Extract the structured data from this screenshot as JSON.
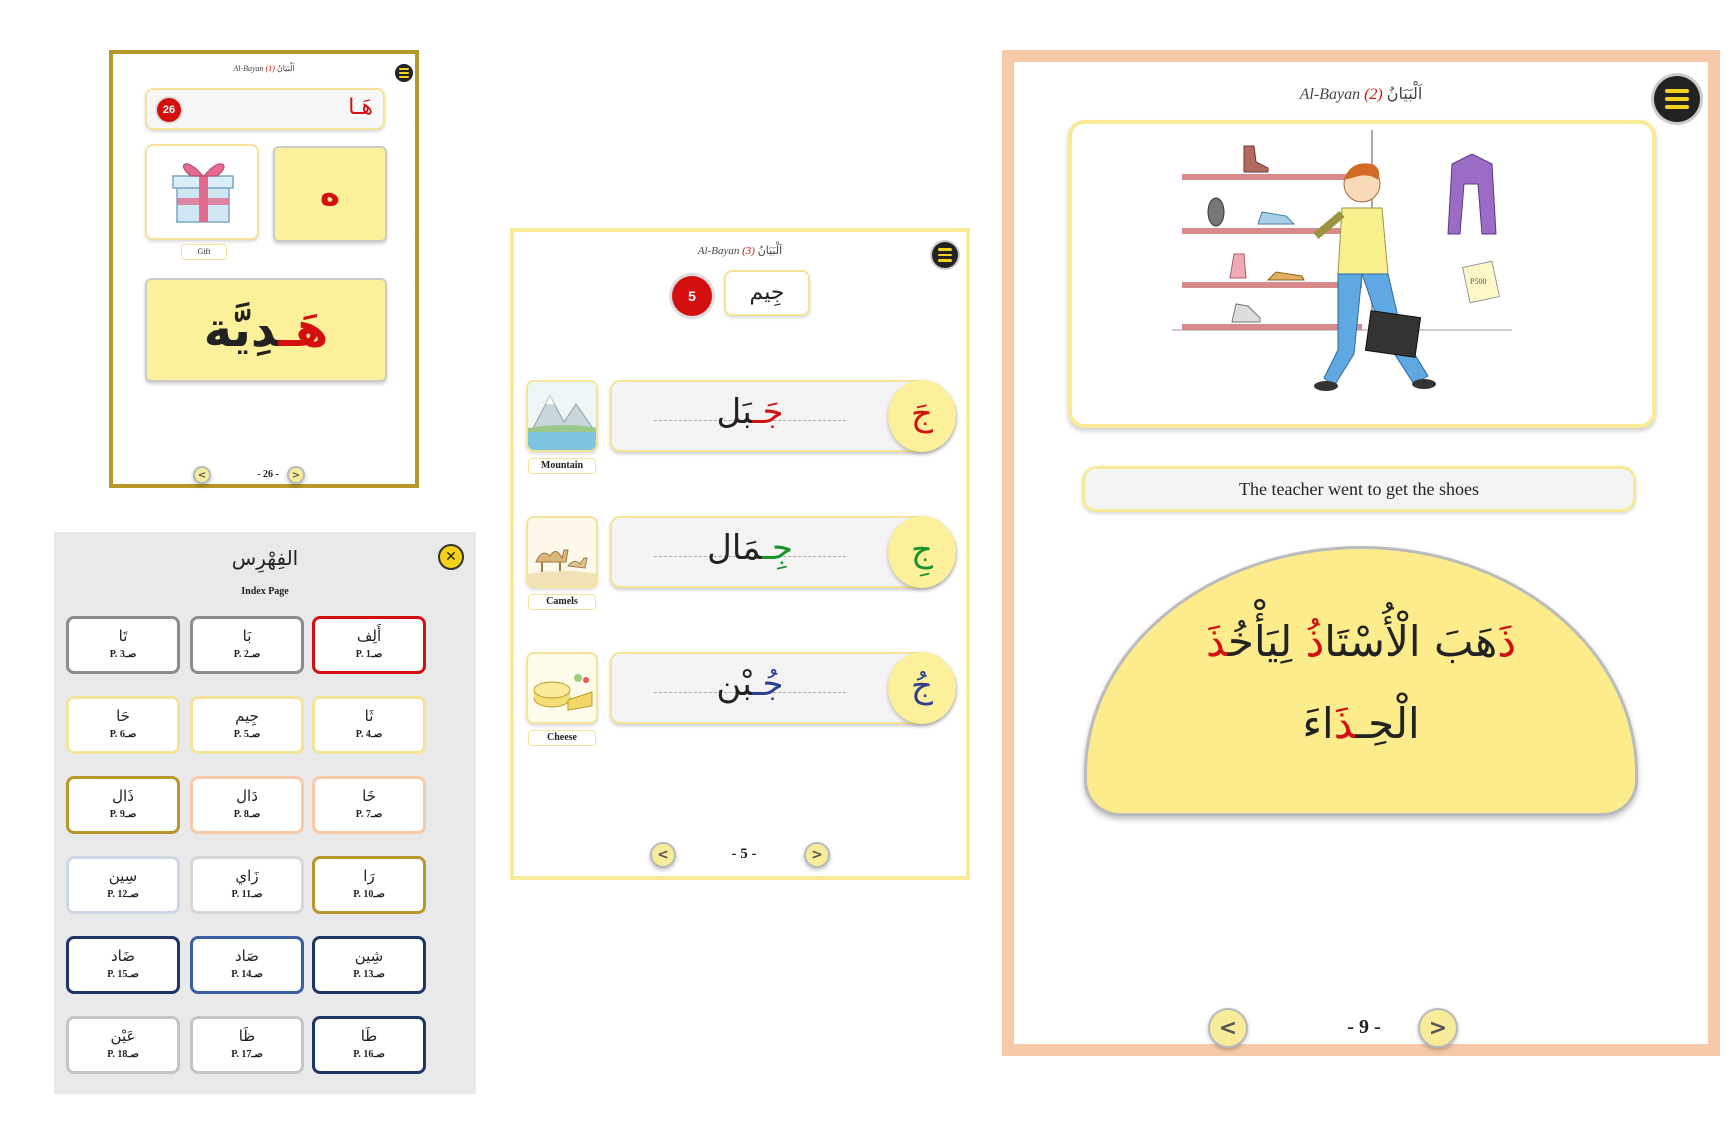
{
  "page26": {
    "header_en": "Al-Bayan",
    "header_num": "(1)",
    "header_ar": "اَلْبَيَانُ",
    "badge": "26",
    "title_word": "هَـا",
    "image_caption": "Gift",
    "letter": "ه",
    "word_red": "هَـ",
    "word_rest": "دِيَّة",
    "prev": "<",
    "next": ">",
    "page_number": "- 26 -"
  },
  "index": {
    "title": "الفِهْرِس",
    "subtitle": "Index Page",
    "close": "✕",
    "items": [
      {
        "name": "تَا",
        "page": "P. 3صـ",
        "border": "#8c8c8c"
      },
      {
        "name": "بَا",
        "page": "P. 2صـ",
        "border": "#8c8c8c"
      },
      {
        "name": "أَلِف",
        "page": "P. 1صـ",
        "border": "#d40f0f"
      },
      {
        "name": "حَا",
        "page": "P. 6صـ",
        "border": "#f4e49a"
      },
      {
        "name": "جِيم",
        "page": "P. 5صـ",
        "border": "#f4e49a"
      },
      {
        "name": "ثَا",
        "page": "P. 4صـ",
        "border": "#f4e49a"
      },
      {
        "name": "ذَال",
        "page": "P. 9صـ",
        "border": "#b8972a"
      },
      {
        "name": "دَال",
        "page": "P. 8صـ",
        "border": "#f6c9a8"
      },
      {
        "name": "خَا",
        "page": "P. 7صـ",
        "border": "#f6c9a8"
      },
      {
        "name": "سِين",
        "page": "P. 12صـ",
        "border": "#cdd7e6"
      },
      {
        "name": "زَاي",
        "page": "P. 11صـ",
        "border": "#d6d6d6"
      },
      {
        "name": "رَا",
        "page": "P. 10صـ",
        "border": "#b8972a"
      },
      {
        "name": "ضَاد",
        "page": "P. 15صـ",
        "border": "#1f3566"
      },
      {
        "name": "صَاد",
        "page": "P. 14صـ",
        "border": "#3b5ea0"
      },
      {
        "name": "شِين",
        "page": "P. 13صـ",
        "border": "#1f3566"
      },
      {
        "name": "عَيْن",
        "page": "P. 18صـ",
        "border": "#c4c4c4"
      },
      {
        "name": "ظَا",
        "page": "P. 17صـ",
        "border": "#c4c4c4"
      },
      {
        "name": "طَا",
        "page": "P. 16صـ",
        "border": "#1f3566"
      }
    ]
  },
  "page5": {
    "header_en": "Al-Bayan",
    "header_num": "(3)",
    "header_ar": "اَلْبَيَانُ",
    "badge": "5",
    "letter_name": "جِيم",
    "rows": [
      {
        "caption": "Mountain",
        "letter": "جَ",
        "letter_color": "#d40f0f",
        "word_colored": "جَـ",
        "word_rest": "بَل"
      },
      {
        "caption": "Camels",
        "letter": "جِ",
        "letter_color": "#18932b",
        "word_colored": "جِـ",
        "word_rest": "مَال"
      },
      {
        "caption": "Cheese",
        "letter": "جُ",
        "letter_color": "#2f3f8f",
        "word_colored": "جُـ",
        "word_rest": "بْن"
      }
    ],
    "prev": "<",
    "next": ">",
    "page_number": "- 5 -"
  },
  "page9": {
    "header_en": "Al-Bayan",
    "header_num": "(2)",
    "header_ar": "اَلْبَيَانُ",
    "caption": "The teacher went to get the shoes",
    "sentence_line1": [
      {
        "t": "ذَ",
        "c": "red"
      },
      {
        "t": "هَبَ ",
        "c": "black"
      },
      {
        "t": "الْأُسْتَا",
        "c": "black"
      },
      {
        "t": "ذُ",
        "c": "red"
      },
      {
        "t": " لِيَأْخُ",
        "c": "black"
      },
      {
        "t": "ذَ",
        "c": "red"
      }
    ],
    "sentence_line2": [
      {
        "t": "الْحِـ",
        "c": "black"
      },
      {
        "t": "ذَ",
        "c": "red"
      },
      {
        "t": "اءَ",
        "c": "black"
      }
    ],
    "scene_price_tag": "P500",
    "prev": "<",
    "next": ">",
    "page_number": "- 9 -"
  }
}
